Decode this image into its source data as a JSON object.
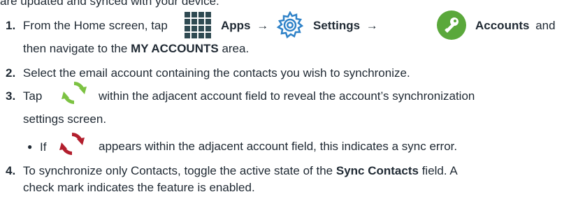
{
  "intro": {
    "text": "are updated and synced with your device."
  },
  "steps": [
    {
      "number": "1.",
      "lead": "From the Home screen, tap",
      "apps": "Apps",
      "arrow1": "→",
      "settings": "Settings",
      "arrow2": "→",
      "accounts": "Accounts",
      "tail": "and",
      "line2_prefix": "then navigate to the",
      "my_accounts": "MY ACCOUNTS",
      "line2_suffix": "area."
    },
    {
      "number": "2.",
      "text": "Select the email account containing the contacts you wish to synchronize."
    },
    {
      "number": "3.",
      "lead": "Tap",
      "rest": "within the adjacent account field to reveal the account’s synchronization",
      "line2": "settings screen."
    },
    {
      "bullet": "●",
      "lead": "If",
      "rest": "appears within the adjacent account field, this indicates a sync error."
    },
    {
      "number": "4.",
      "prefix": "To synchronize only Contacts, toggle the active state of the",
      "field": "Sync Contacts",
      "suffix": "field. A",
      "line2": "check mark indicates the feature is enabled."
    }
  ],
  "icons": {
    "apps": "apps-grid-icon",
    "settings": "settings-gear-icon",
    "accounts": "accounts-key-icon",
    "sync": "sync-icon",
    "sync_error": "sync-error-icon"
  },
  "colors": {
    "text": "#1f2933",
    "apps_icon": "#2f4a52",
    "settings_icon": "#2f82c8",
    "accounts_icon": "#5aa83b",
    "sync_icon": "#7cc242",
    "sync_error_icon": "#b21e2d"
  }
}
